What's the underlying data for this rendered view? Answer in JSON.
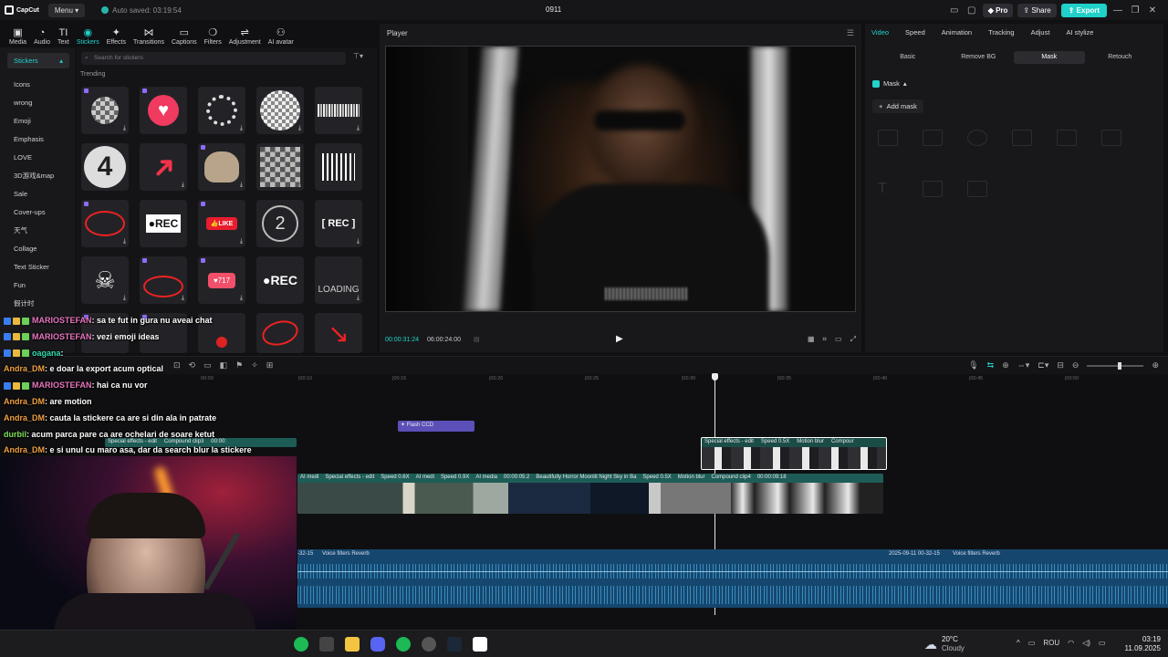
{
  "app": {
    "logo_text": "CapCut",
    "menu_label": "Menu",
    "autosave_text": "Auto saved: 03:19:54",
    "project_title": "0911",
    "pro_label": "Pro",
    "share_label": "Share",
    "export_label": "Export",
    "accent_color": "#23d2c9"
  },
  "tools": [
    {
      "label": "Media",
      "icon": "media-icon",
      "glyph": "▣"
    },
    {
      "label": "Audio",
      "icon": "audio-icon",
      "glyph": "◔"
    },
    {
      "label": "Text",
      "icon": "text-icon",
      "glyph": "TI"
    },
    {
      "label": "Stickers",
      "icon": "stickers-icon",
      "glyph": "◉"
    },
    {
      "label": "Effects",
      "icon": "effects-icon",
      "glyph": "✦"
    },
    {
      "label": "Transitions",
      "icon": "transitions-icon",
      "glyph": "⋈"
    },
    {
      "label": "Captions",
      "icon": "captions-icon",
      "glyph": "▭"
    },
    {
      "label": "Filters",
      "icon": "filters-icon",
      "glyph": "❍"
    },
    {
      "label": "Adjustment",
      "icon": "adjustment-icon",
      "glyph": "⇌"
    },
    {
      "label": "AI avatar",
      "icon": "ai-avatar-icon",
      "glyph": "⚇"
    }
  ],
  "sidebar": {
    "header": "Stickers",
    "items": [
      "Icons",
      "wrong",
      "Emoji",
      "Emphasis",
      "LOVE",
      "3D游戏&map",
      "Sale",
      "Cover-ups",
      "天气",
      "Collage",
      "Text Sticker",
      "Fun",
      "假计时"
    ]
  },
  "stickers": {
    "search_placeholder": "Search for stickers",
    "section_label": "Trending",
    "item_texts": {
      "number4": "4",
      "rec_white": "●REC",
      "like": "👍LIKE",
      "count_2": "2",
      "rec_frame": "[ REC ]",
      "heart_count": "♥717",
      "rec_plain": "●REC",
      "loading": "LOADING"
    }
  },
  "player": {
    "title": "Player",
    "current_time": "00:00:31:24",
    "total_time": "06:00:24:00"
  },
  "right_panel": {
    "tabs": [
      "Video",
      "Speed",
      "Animation",
      "Tracking",
      "Adjust",
      "AI stylize"
    ],
    "subtabs": [
      "Basic",
      "Remove BG",
      "Mask",
      "Retouch"
    ],
    "mask_label": "Mask",
    "add_mask_label": "Add mask"
  },
  "timeline": {
    "ruler_ticks": [
      "00:00",
      "|00:10",
      "|00:15",
      "|00:20",
      "|00:25",
      "|00:30",
      "|00:35",
      "|00:40",
      "|00:45",
      "|00:50"
    ],
    "effect_clip": "Flash CCD",
    "overlay_clip_labels": [
      "Special effects - edit",
      "Speed 0.5X",
      "Motion blur",
      "Compour"
    ],
    "overlay_left_labels": [
      "Special effects - edit",
      "Compound clip3",
      "00:00:"
    ],
    "main_clip_labels": [
      "AI medi",
      "Special effects - edit",
      "Speed 0.6X",
      "AI medi",
      "Speed 0.9X",
      "AI media",
      "00:00:05:2",
      "Beautifully Horror Moonlit Night Sky in Ba",
      "Speed 0.5X",
      "Motion blur",
      "Compound clip4",
      "00:00:09:18"
    ],
    "audio_labels": [
      "-32-15",
      "Voice filters Reverb",
      "2025-09-11 00-32-15",
      "Voice filters Reverb"
    ]
  },
  "chat": [
    {
      "user": "MARIOSTEFAN",
      "text": ": sa te fut in gura nu aveai chat",
      "color_class": "u1",
      "badges": 3
    },
    {
      "user": "MARIOSTEFAN",
      "text": ": vezi emoji ideas",
      "color_class": "u1",
      "badges": 3
    },
    {
      "user": "oagana",
      "text": ":",
      "color_class": "u3",
      "badges": 3
    },
    {
      "user": "Andra_DM",
      "text": ": e doar la export acum optical",
      "color_class": "u2",
      "badges": 0
    },
    {
      "user": "MARIOSTEFAN",
      "text": ": hai ca nu vor",
      "color_class": "u1",
      "badges": 3
    },
    {
      "user": "Andra_DM",
      "text": ": are motion",
      "color_class": "u2",
      "badges": 0
    },
    {
      "user": "Andra_DM",
      "text": ": cauta la stickere ca are si din ala in patrate",
      "color_class": "u2",
      "badges": 0
    },
    {
      "user": "durbil",
      "text": ": acum parca pare ca are ochelari de soare ketut",
      "color_class": "u4",
      "badges": 0
    },
    {
      "user": "Andra_DM",
      "text": ": e si unul cu maro asa, dar da search blur la stickere",
      "color_class": "u2",
      "badges": 0
    }
  ],
  "taskbar": {
    "temperature": "20°C",
    "condition": "Cloudy",
    "language": "ROU",
    "time": "03:19",
    "date": "11.09.2025"
  }
}
